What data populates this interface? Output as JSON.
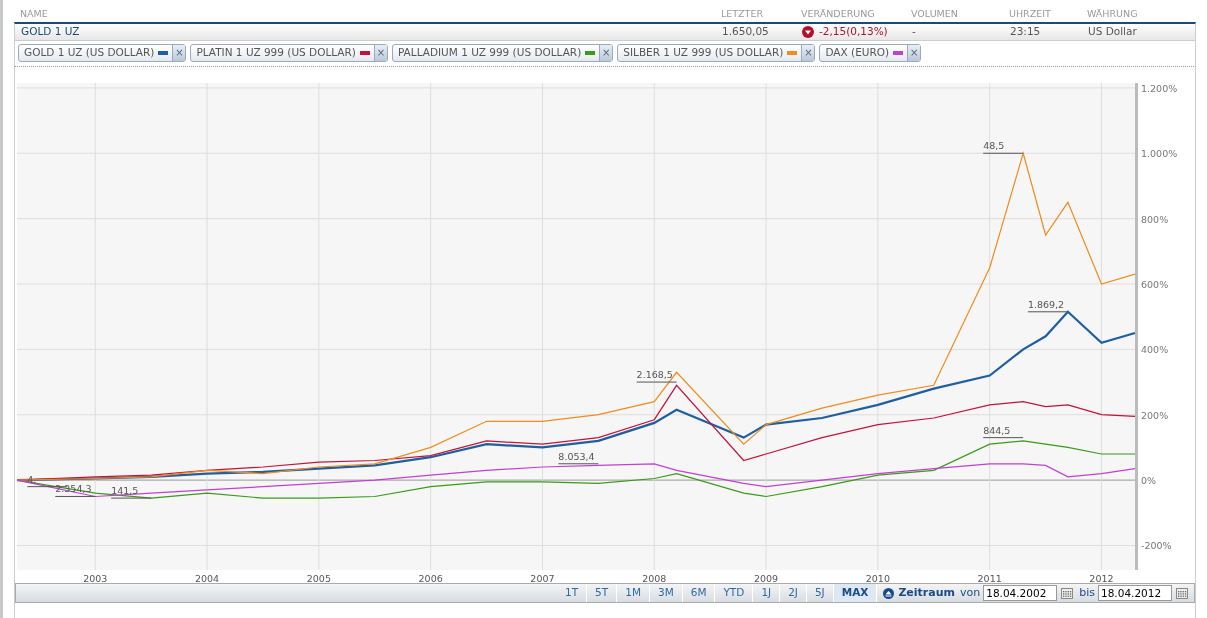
{
  "table": {
    "columns": [
      "NAME",
      "LETZTER",
      "VERÄNDERUNG",
      "VOLUMEN",
      "UHRZEIT",
      "WÄHRUNG"
    ],
    "row": {
      "name": "GOLD 1 UZ",
      "last": "1.650,05",
      "change": "-2,15(0,13%)",
      "down": true,
      "volume": "-",
      "time": "23:15",
      "currency": "US Dollar"
    }
  },
  "chart": {
    "legend_close": "×",
    "chart_data": {
      "type": "line",
      "grid": true,
      "x": [
        2002.3,
        2003,
        2003.5,
        2004,
        2004.5,
        2005,
        2005.5,
        2006,
        2006.5,
        2007,
        2007.5,
        2008,
        2008.2,
        2008.8,
        2009,
        2009.5,
        2010,
        2010.5,
        2011,
        2011.3,
        2011.5,
        2011.7,
        2012,
        2012.3
      ],
      "series": [
        {
          "name": "GOLD 1 UZ (US DOLLAR)",
          "color": "#1f5fa0",
          "values": [
            0,
            5,
            10,
            20,
            25,
            35,
            45,
            70,
            110,
            100,
            120,
            175,
            215,
            130,
            170,
            190,
            230,
            280,
            320,
            400,
            440,
            515,
            420,
            450
          ]
        },
        {
          "name": "PLATIN 1 UZ 999 (US DOLLAR)",
          "color": "#c0143c",
          "values": [
            0,
            10,
            15,
            30,
            40,
            55,
            60,
            75,
            120,
            110,
            130,
            185,
            290,
            60,
            80,
            130,
            170,
            190,
            230,
            240,
            225,
            230,
            200,
            195
          ]
        },
        {
          "name": "PALLADIUM 1 UZ 999 (US DOLLAR)",
          "color": "#3a9a1a",
          "values": [
            0,
            -40,
            -55,
            -40,
            -55,
            -55,
            -50,
            -20,
            -5,
            -5,
            -10,
            5,
            20,
            -40,
            -50,
            -20,
            15,
            30,
            110,
            120,
            110,
            100,
            80,
            80
          ]
        },
        {
          "name": "SILBER 1 UZ 999 (US DOLLAR)",
          "color": "#f08c1e",
          "values": [
            0,
            5,
            10,
            30,
            20,
            40,
            50,
            100,
            180,
            180,
            200,
            240,
            330,
            110,
            170,
            220,
            260,
            290,
            650,
            1000,
            750,
            850,
            600,
            630
          ]
        },
        {
          "name": "DAX (EURO)",
          "color": "#c040d0",
          "values": [
            0,
            -50,
            -40,
            -30,
            -20,
            -10,
            0,
            15,
            30,
            40,
            45,
            50,
            30,
            -10,
            -20,
            0,
            20,
            35,
            50,
            50,
            45,
            10,
            20,
            35
          ]
        }
      ],
      "xlim": [
        2002.3,
        2012.3
      ],
      "ylim": [
        -275,
        1215
      ],
      "xticks": [
        {
          "value": 2003,
          "label": "2003"
        },
        {
          "value": 2004,
          "label": "2004"
        },
        {
          "value": 2005,
          "label": "2005"
        },
        {
          "value": 2006,
          "label": "2006"
        },
        {
          "value": 2007,
          "label": "2007"
        },
        {
          "value": 2008,
          "label": "2008"
        },
        {
          "value": 2009,
          "label": "2009"
        },
        {
          "value": 2010,
          "label": "2010"
        },
        {
          "value": 2011,
          "label": "2011"
        },
        {
          "value": 2012,
          "label": "2012"
        }
      ],
      "yticks": [
        {
          "value": -200,
          "label": "-200%"
        },
        {
          "value": 0,
          "label": "0%"
        },
        {
          "value": 200,
          "label": "200%"
        },
        {
          "value": 400,
          "label": "400%"
        },
        {
          "value": 600,
          "label": "600%"
        },
        {
          "value": 800,
          "label": "800%"
        },
        {
          "value": 1000,
          "label": "1.000%"
        },
        {
          "value": 1200,
          "label": "1.200%"
        }
      ],
      "annotations": [
        {
          "text": "48,5",
          "x": 2011.3,
          "y": 1000
        },
        {
          "text": "1.869,2",
          "x": 2011.7,
          "y": 515
        },
        {
          "text": "2.168,5",
          "x": 2008.2,
          "y": 300
        },
        {
          "text": "8.053,4",
          "x": 2007.5,
          "y": 50
        },
        {
          "text": "844,5",
          "x": 2011.3,
          "y": 130
        },
        {
          "text": "4,",
          "x": 2002.75,
          "y": -20
        },
        {
          "text": "2.354,3",
          "x": 2003,
          "y": -50
        },
        {
          "text": "141,5",
          "x": 2003.5,
          "y": -55
        }
      ]
    }
  },
  "toolbar": {
    "periods": [
      {
        "label": "1T",
        "selected": false
      },
      {
        "label": "5T",
        "selected": false
      },
      {
        "label": "1M",
        "selected": false
      },
      {
        "label": "3M",
        "selected": false
      },
      {
        "label": "6M",
        "selected": false
      },
      {
        "label": "YTD",
        "selected": false
      },
      {
        "label": "1J",
        "selected": false
      },
      {
        "label": "2J",
        "selected": false
      },
      {
        "label": "5J",
        "selected": false
      },
      {
        "label": "MAX",
        "selected": true
      }
    ],
    "range_label": "Zeitraum",
    "from_label": "von",
    "from": "18.04.2002",
    "to_label": "bis",
    "to": "18.04.2012"
  }
}
